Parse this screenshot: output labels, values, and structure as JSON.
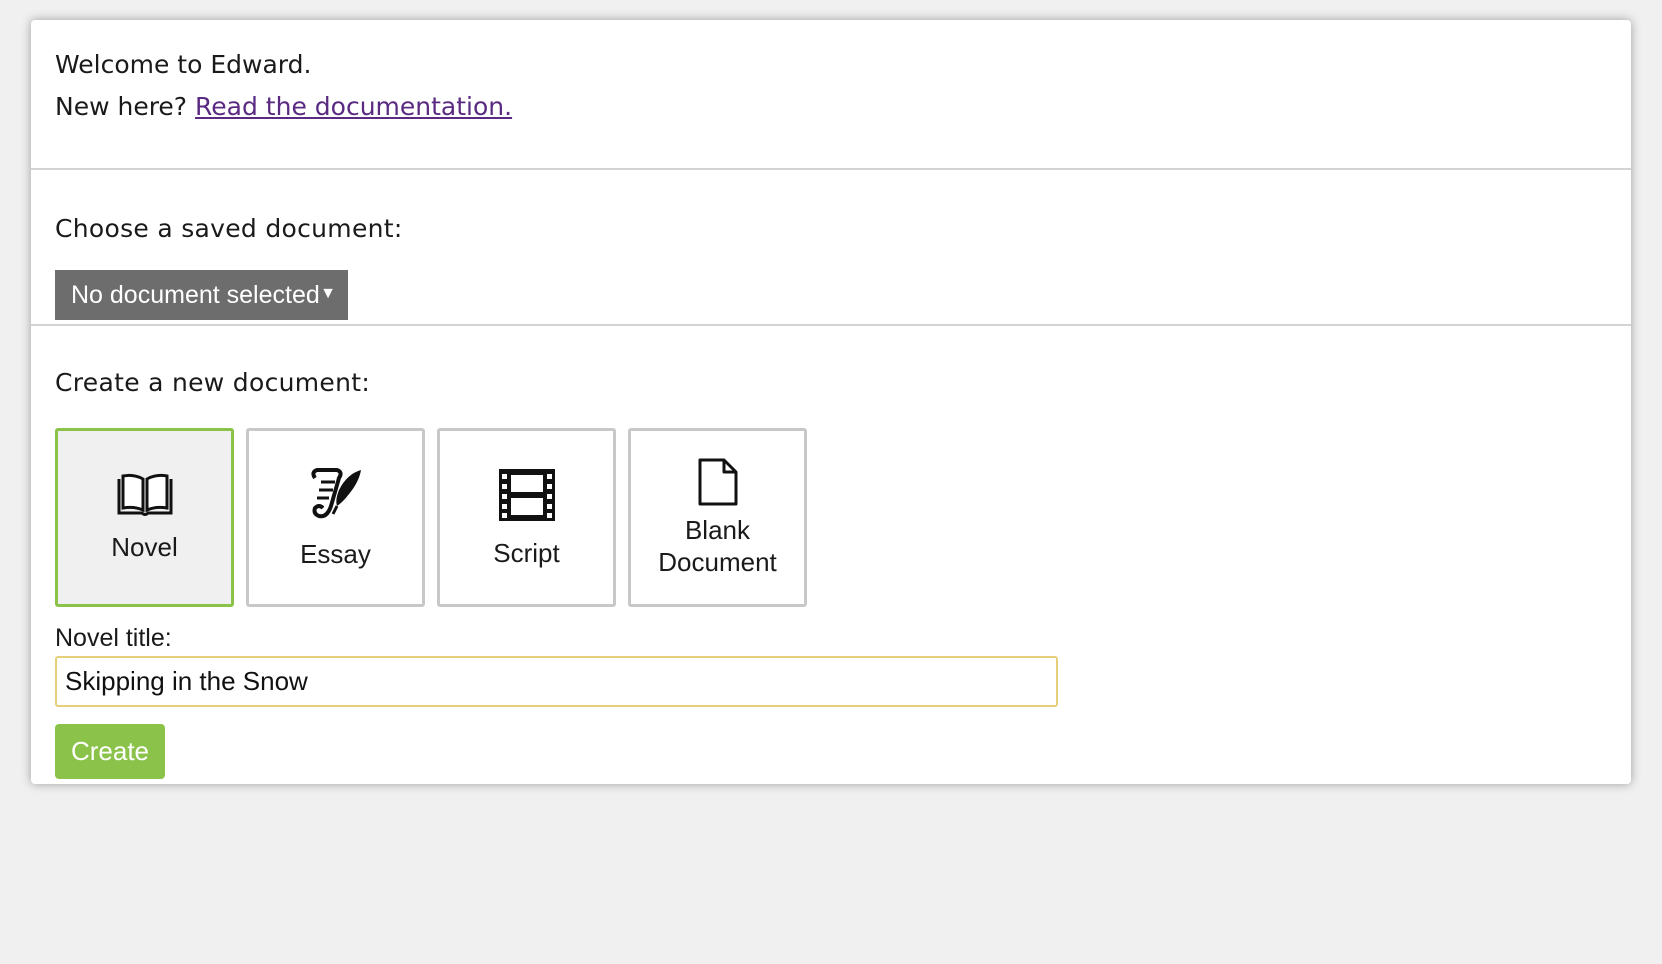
{
  "welcome": {
    "title": "Welcome to Edward.",
    "prompt": "New here?",
    "doc_link": "Read the documentation."
  },
  "saved": {
    "label": "Choose a saved document:",
    "selected_value": "No document selected",
    "caret_icon": "triangle-down"
  },
  "create": {
    "label": "Create a new document:",
    "types": [
      {
        "label": "Novel",
        "icon": "open-book-icon",
        "selected": true
      },
      {
        "label": "Essay",
        "icon": "quill-scroll-icon",
        "selected": false
      },
      {
        "label": "Script",
        "icon": "film-strip-icon",
        "selected": false
      },
      {
        "label": "Blank\nDocument",
        "icon": "blank-page-icon",
        "selected": false
      }
    ],
    "title_label": "Novel title:",
    "title_value": "Skipping in the Snow",
    "button_label": "Create"
  },
  "colors": {
    "accent_green": "#8bc34a",
    "select_gray": "#6d6d6d",
    "link_purple": "#5a2a82",
    "input_border": "#e6cf7a"
  }
}
